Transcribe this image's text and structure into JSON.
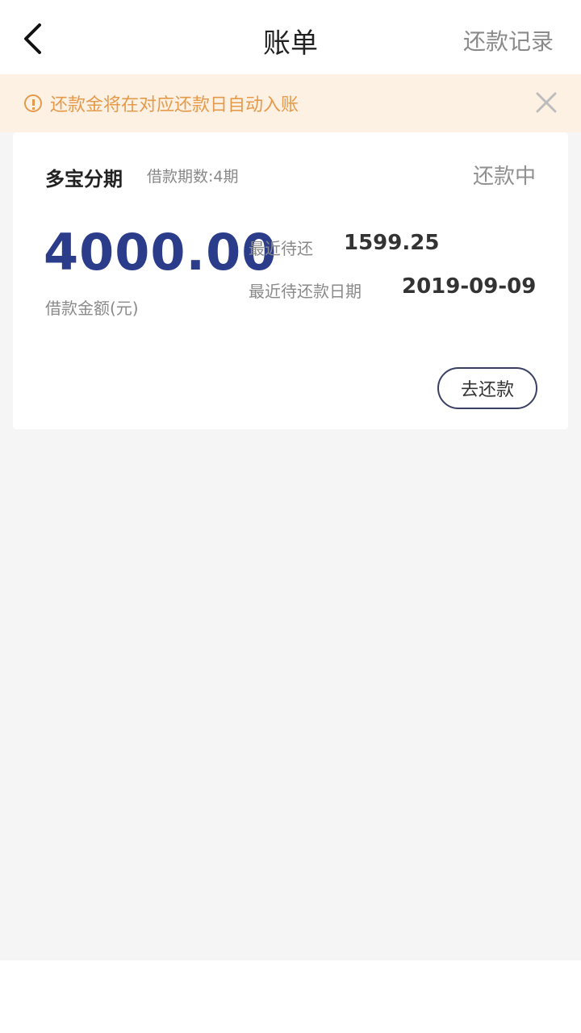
{
  "navbar": {
    "back_icon": "back-arrow-icon",
    "title": "账单",
    "right_label": "还款记录"
  },
  "notice": {
    "icon": "info-circle-icon",
    "text": "还款金将在对应还款日自动入账",
    "close_icon": "close-icon",
    "color": "#e59a4b",
    "background": "#fdf1e4"
  },
  "loan_card": {
    "product_name": "多宝分期",
    "periods_text": "借款期数:4期",
    "status": "还款中",
    "amount": "4000.00",
    "amount_label": "借款金额(元)",
    "recent_due_label": "最近待还",
    "recent_due_value": "1599.25",
    "recent_due_date_label": "最近待还款日期",
    "recent_due_date_value": "2019-09-09",
    "repay_button_label": "去还款",
    "amount_color": "#2b3c8a"
  }
}
